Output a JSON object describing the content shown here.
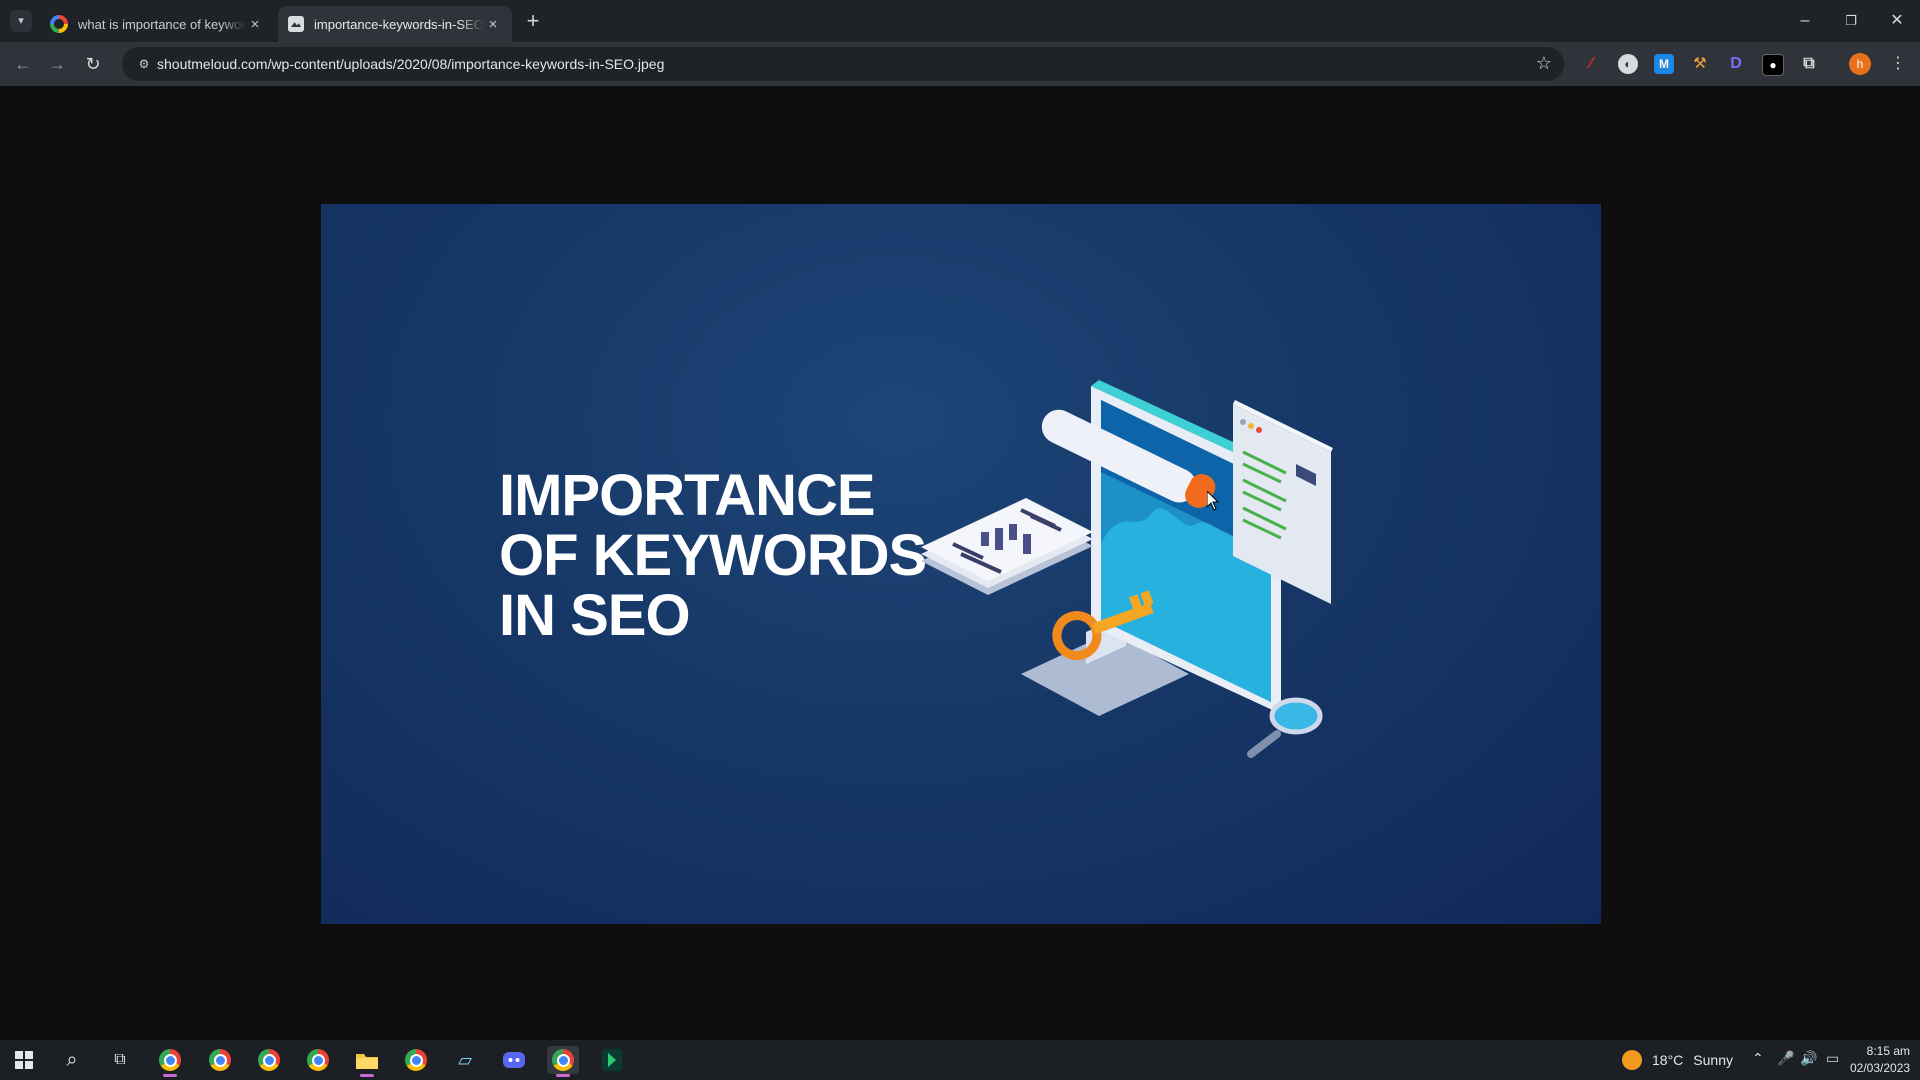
{
  "browser": {
    "tabs": [
      {
        "title": "what is importance of keywords",
        "favicon": "google-icon",
        "active": false
      },
      {
        "title": "importance-keywords-in-SEO.jpeg",
        "favicon": "image-icon",
        "active": true
      }
    ],
    "new_tab_label": "+",
    "window_controls": {
      "minimize": "–",
      "restore": "❐",
      "close": "✕"
    },
    "nav": {
      "back": "←",
      "forward": "→",
      "reload": "↻"
    },
    "url": "shoutmeloud.com/wp-content/uploads/2020/08/importance-keywords-in-SEO.jpeg",
    "profile_initial": "h"
  },
  "image": {
    "headline_lines": [
      "IMPORTANCE",
      "OF KEYWORDS",
      "IN SEO"
    ],
    "background_color": "#163766"
  },
  "taskbar": {
    "weather": {
      "temperature": "18°C",
      "condition": "Sunny"
    },
    "clock": {
      "time": "8:15 am",
      "date": "02/03/2023"
    }
  }
}
